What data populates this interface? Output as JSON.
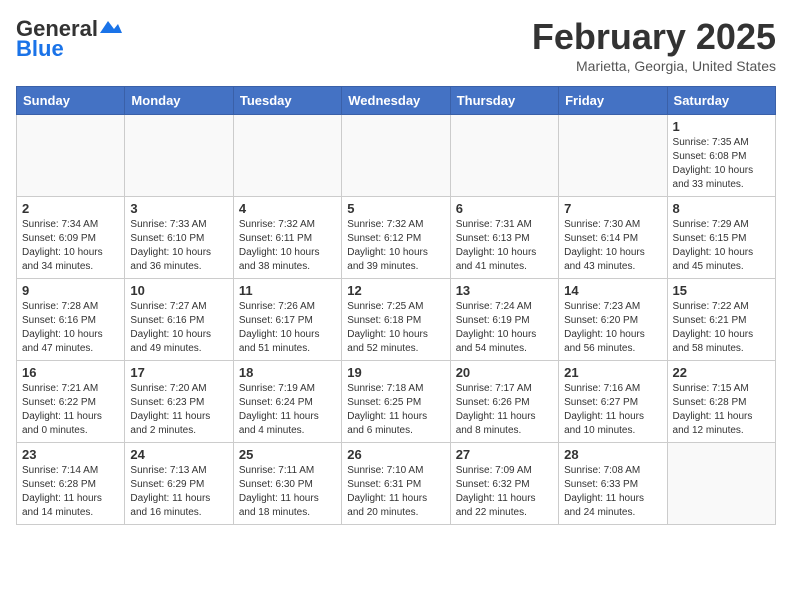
{
  "header": {
    "logo_general": "General",
    "logo_blue": "Blue",
    "month_title": "February 2025",
    "location": "Marietta, Georgia, United States"
  },
  "days_of_week": [
    "Sunday",
    "Monday",
    "Tuesday",
    "Wednesday",
    "Thursday",
    "Friday",
    "Saturday"
  ],
  "weeks": [
    [
      {
        "day": "",
        "info": ""
      },
      {
        "day": "",
        "info": ""
      },
      {
        "day": "",
        "info": ""
      },
      {
        "day": "",
        "info": ""
      },
      {
        "day": "",
        "info": ""
      },
      {
        "day": "",
        "info": ""
      },
      {
        "day": "1",
        "info": "Sunrise: 7:35 AM\nSunset: 6:08 PM\nDaylight: 10 hours\nand 33 minutes."
      }
    ],
    [
      {
        "day": "2",
        "info": "Sunrise: 7:34 AM\nSunset: 6:09 PM\nDaylight: 10 hours\nand 34 minutes."
      },
      {
        "day": "3",
        "info": "Sunrise: 7:33 AM\nSunset: 6:10 PM\nDaylight: 10 hours\nand 36 minutes."
      },
      {
        "day": "4",
        "info": "Sunrise: 7:32 AM\nSunset: 6:11 PM\nDaylight: 10 hours\nand 38 minutes."
      },
      {
        "day": "5",
        "info": "Sunrise: 7:32 AM\nSunset: 6:12 PM\nDaylight: 10 hours\nand 39 minutes."
      },
      {
        "day": "6",
        "info": "Sunrise: 7:31 AM\nSunset: 6:13 PM\nDaylight: 10 hours\nand 41 minutes."
      },
      {
        "day": "7",
        "info": "Sunrise: 7:30 AM\nSunset: 6:14 PM\nDaylight: 10 hours\nand 43 minutes."
      },
      {
        "day": "8",
        "info": "Sunrise: 7:29 AM\nSunset: 6:15 PM\nDaylight: 10 hours\nand 45 minutes."
      }
    ],
    [
      {
        "day": "9",
        "info": "Sunrise: 7:28 AM\nSunset: 6:16 PM\nDaylight: 10 hours\nand 47 minutes."
      },
      {
        "day": "10",
        "info": "Sunrise: 7:27 AM\nSunset: 6:16 PM\nDaylight: 10 hours\nand 49 minutes."
      },
      {
        "day": "11",
        "info": "Sunrise: 7:26 AM\nSunset: 6:17 PM\nDaylight: 10 hours\nand 51 minutes."
      },
      {
        "day": "12",
        "info": "Sunrise: 7:25 AM\nSunset: 6:18 PM\nDaylight: 10 hours\nand 52 minutes."
      },
      {
        "day": "13",
        "info": "Sunrise: 7:24 AM\nSunset: 6:19 PM\nDaylight: 10 hours\nand 54 minutes."
      },
      {
        "day": "14",
        "info": "Sunrise: 7:23 AM\nSunset: 6:20 PM\nDaylight: 10 hours\nand 56 minutes."
      },
      {
        "day": "15",
        "info": "Sunrise: 7:22 AM\nSunset: 6:21 PM\nDaylight: 10 hours\nand 58 minutes."
      }
    ],
    [
      {
        "day": "16",
        "info": "Sunrise: 7:21 AM\nSunset: 6:22 PM\nDaylight: 11 hours\nand 0 minutes."
      },
      {
        "day": "17",
        "info": "Sunrise: 7:20 AM\nSunset: 6:23 PM\nDaylight: 11 hours\nand 2 minutes."
      },
      {
        "day": "18",
        "info": "Sunrise: 7:19 AM\nSunset: 6:24 PM\nDaylight: 11 hours\nand 4 minutes."
      },
      {
        "day": "19",
        "info": "Sunrise: 7:18 AM\nSunset: 6:25 PM\nDaylight: 11 hours\nand 6 minutes."
      },
      {
        "day": "20",
        "info": "Sunrise: 7:17 AM\nSunset: 6:26 PM\nDaylight: 11 hours\nand 8 minutes."
      },
      {
        "day": "21",
        "info": "Sunrise: 7:16 AM\nSunset: 6:27 PM\nDaylight: 11 hours\nand 10 minutes."
      },
      {
        "day": "22",
        "info": "Sunrise: 7:15 AM\nSunset: 6:28 PM\nDaylight: 11 hours\nand 12 minutes."
      }
    ],
    [
      {
        "day": "23",
        "info": "Sunrise: 7:14 AM\nSunset: 6:28 PM\nDaylight: 11 hours\nand 14 minutes."
      },
      {
        "day": "24",
        "info": "Sunrise: 7:13 AM\nSunset: 6:29 PM\nDaylight: 11 hours\nand 16 minutes."
      },
      {
        "day": "25",
        "info": "Sunrise: 7:11 AM\nSunset: 6:30 PM\nDaylight: 11 hours\nand 18 minutes."
      },
      {
        "day": "26",
        "info": "Sunrise: 7:10 AM\nSunset: 6:31 PM\nDaylight: 11 hours\nand 20 minutes."
      },
      {
        "day": "27",
        "info": "Sunrise: 7:09 AM\nSunset: 6:32 PM\nDaylight: 11 hours\nand 22 minutes."
      },
      {
        "day": "28",
        "info": "Sunrise: 7:08 AM\nSunset: 6:33 PM\nDaylight: 11 hours\nand 24 minutes."
      },
      {
        "day": "",
        "info": ""
      }
    ]
  ]
}
